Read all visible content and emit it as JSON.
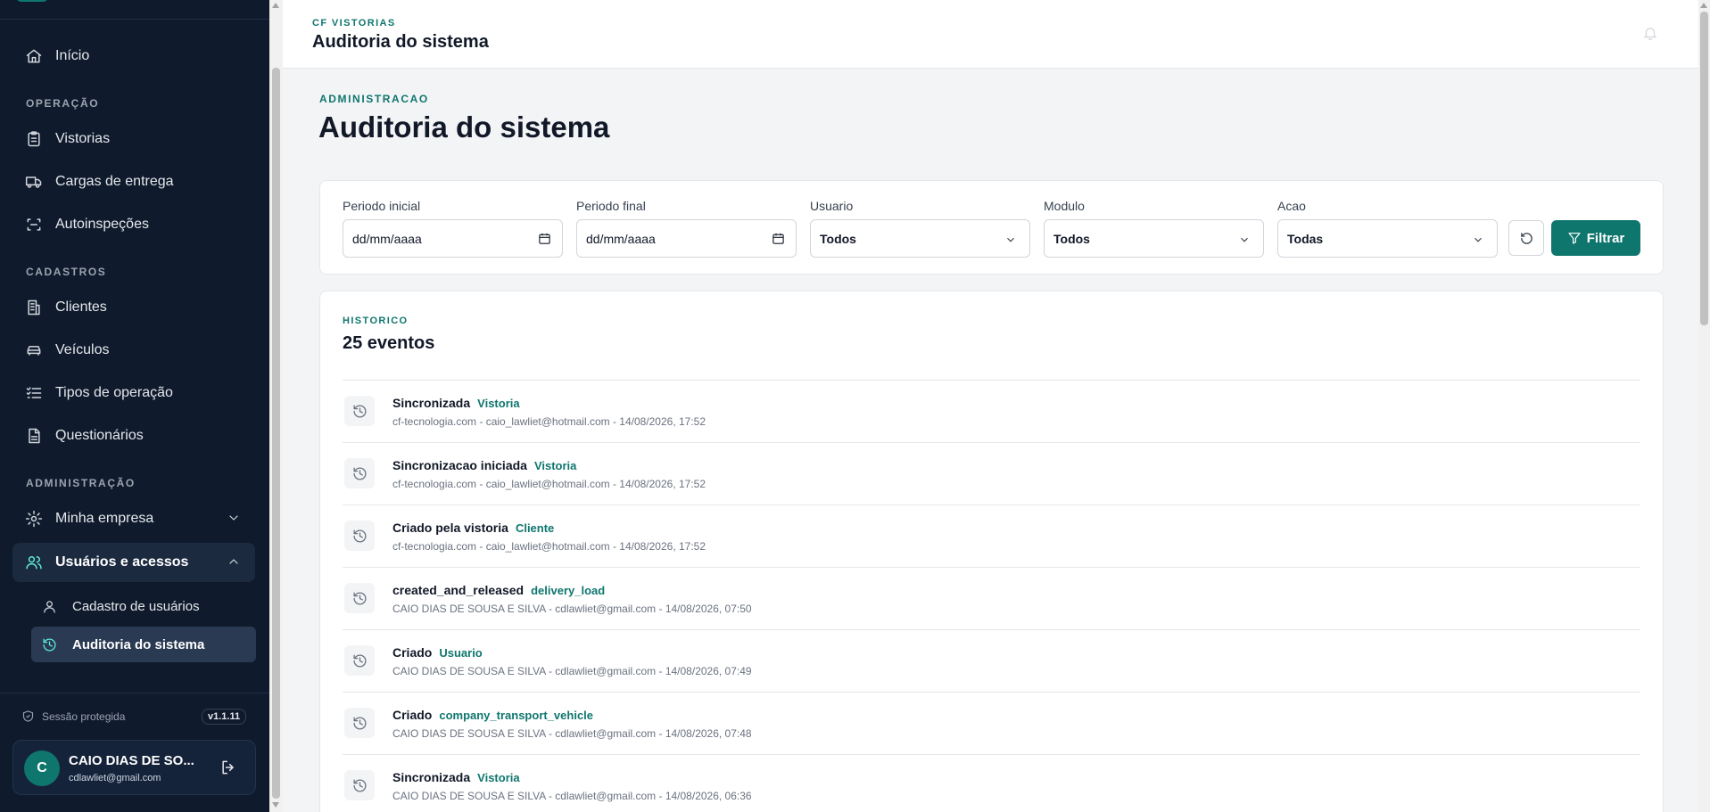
{
  "sidebar": {
    "home": "Início",
    "sections": {
      "operacao": "OPERAÇÃO",
      "cadastros": "CADASTROS",
      "administracao": "ADMINISTRAÇÃO"
    },
    "operacao_items": [
      "Vistorias",
      "Cargas de entrega",
      "Autoinspeções"
    ],
    "cadastros_items": [
      "Clientes",
      "Veículos",
      "Tipos de operação",
      "Questionários"
    ],
    "admin_items": {
      "minha_empresa": "Minha empresa",
      "usuarios_acessos": "Usuários e acessos",
      "sub": [
        "Cadastro de usuários",
        "Auditoria do sistema"
      ]
    },
    "session": "Sessão protegida",
    "version": "v1.1.11",
    "user": {
      "initial": "C",
      "name": "CAIO DIAS DE SO...",
      "email": "cdlawliet@gmail.com"
    }
  },
  "header": {
    "kicker": "CF VISTORIAS",
    "title": "Auditoria do sistema"
  },
  "page": {
    "kicker": "ADMINISTRACAO",
    "title": "Auditoria do sistema"
  },
  "filters": {
    "periodo_inicial": {
      "label": "Periodo inicial",
      "placeholder": "dd/mm/aaaa"
    },
    "periodo_final": {
      "label": "Periodo final",
      "placeholder": "dd/mm/aaaa"
    },
    "usuario": {
      "label": "Usuario",
      "value": "Todos"
    },
    "modulo": {
      "label": "Modulo",
      "value": "Todos"
    },
    "acao": {
      "label": "Acao",
      "value": "Todas"
    },
    "filter_button": "Filtrar"
  },
  "history": {
    "kicker": "HISTORICO",
    "title": "25 eventos",
    "events": [
      {
        "action": "Sincronizada",
        "module": "Vistoria",
        "meta": "cf-tecnologia.com - caio_lawliet@hotmail.com - 14/08/2026, 17:52"
      },
      {
        "action": "Sincronizacao iniciada",
        "module": "Vistoria",
        "meta": "cf-tecnologia.com - caio_lawliet@hotmail.com - 14/08/2026, 17:52"
      },
      {
        "action": "Criado pela vistoria",
        "module": "Cliente",
        "meta": "cf-tecnologia.com - caio_lawliet@hotmail.com - 14/08/2026, 17:52"
      },
      {
        "action": "created_and_released",
        "module": "delivery_load",
        "meta": "CAIO DIAS DE SOUSA E SILVA - cdlawliet@gmail.com - 14/08/2026, 07:50"
      },
      {
        "action": "Criado",
        "module": "Usuario",
        "meta": "CAIO DIAS DE SOUSA E SILVA - cdlawliet@gmail.com - 14/08/2026, 07:49"
      },
      {
        "action": "Criado",
        "module": "company_transport_vehicle",
        "meta": "CAIO DIAS DE SOUSA E SILVA - cdlawliet@gmail.com - 14/08/2026, 07:48"
      },
      {
        "action": "Sincronizada",
        "module": "Vistoria",
        "meta": "CAIO DIAS DE SOUSA E SILVA - cdlawliet@gmail.com - 14/08/2026, 06:36"
      }
    ]
  },
  "colors": {
    "sidebar_bg": "#0f1b2d",
    "accent": "#0f766e",
    "page_bg": "#f3f4f6"
  }
}
